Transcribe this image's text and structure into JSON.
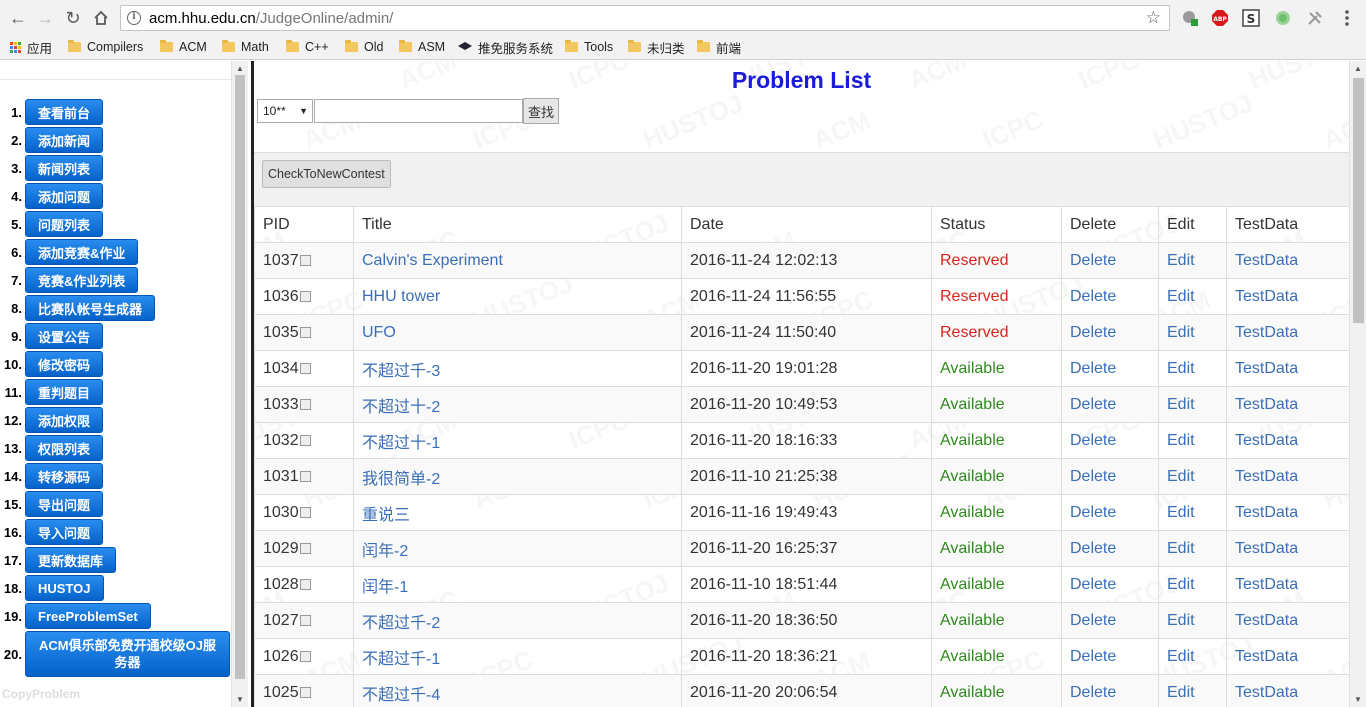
{
  "browser": {
    "url_host": "acm.hhu.edu.cn",
    "url_path": "/JudgeOnline/admin/"
  },
  "bookmarks": [
    {
      "label": "应用",
      "icon": "apps-grid-icon"
    },
    {
      "label": "Compilers",
      "icon": "folder-icon"
    },
    {
      "label": "ACM",
      "icon": "folder-icon"
    },
    {
      "label": "Math",
      "icon": "folder-icon"
    },
    {
      "label": "C++",
      "icon": "folder-icon"
    },
    {
      "label": "Old",
      "icon": "folder-icon"
    },
    {
      "label": "ASM",
      "icon": "folder-icon"
    },
    {
      "label": "推免服务系统",
      "icon": "graduation-cap-icon"
    },
    {
      "label": "Tools",
      "icon": "folder-icon"
    },
    {
      "label": "未归类",
      "icon": "folder-icon"
    },
    {
      "label": "前端",
      "icon": "folder-icon"
    }
  ],
  "sidebar": {
    "items": [
      {
        "num": "1.",
        "label": "查看前台"
      },
      {
        "num": "2.",
        "label": "添加新闻"
      },
      {
        "num": "3.",
        "label": "新闻列表"
      },
      {
        "num": "4.",
        "label": "添加问题"
      },
      {
        "num": "5.",
        "label": "问题列表"
      },
      {
        "num": "6.",
        "label": "添加竞赛&作业"
      },
      {
        "num": "7.",
        "label": "竞赛&作业列表"
      },
      {
        "num": "8.",
        "label": "比赛队帐号生成器"
      },
      {
        "num": "9.",
        "label": "设置公告"
      },
      {
        "num": "10.",
        "label": "修改密码"
      },
      {
        "num": "11.",
        "label": "重判题目"
      },
      {
        "num": "12.",
        "label": "添加权限"
      },
      {
        "num": "13.",
        "label": "权限列表"
      },
      {
        "num": "14.",
        "label": "转移源码"
      },
      {
        "num": "15.",
        "label": "导出问题"
      },
      {
        "num": "16.",
        "label": "导入问题"
      },
      {
        "num": "17.",
        "label": "更新数据库"
      },
      {
        "num": "18.",
        "label": "HUSTOJ"
      },
      {
        "num": "19.",
        "label": "FreeProblemSet"
      },
      {
        "num": "20.",
        "label": "ACM俱乐部免费开通校级OJ服务器"
      }
    ],
    "footer": "CopyProblem"
  },
  "main": {
    "title": "Problem List",
    "filter_value": "10**",
    "search_button": "查找",
    "check_button": "CheckToNewContest",
    "columns": [
      "PID",
      "Title",
      "Date",
      "Status",
      "Delete",
      "Edit",
      "TestData"
    ],
    "rows": [
      {
        "pid": "1037",
        "title": "Calvin's Experiment",
        "date": "2016-11-24 12:02:13",
        "status": "Reserved",
        "del": "Delete",
        "edit": "Edit",
        "test": "TestData"
      },
      {
        "pid": "1036",
        "title": "HHU tower",
        "date": "2016-11-24 11:56:55",
        "status": "Reserved",
        "del": "Delete",
        "edit": "Edit",
        "test": "TestData"
      },
      {
        "pid": "1035",
        "title": "UFO",
        "date": "2016-11-24 11:50:40",
        "status": "Reserved",
        "del": "Delete",
        "edit": "Edit",
        "test": "TestData"
      },
      {
        "pid": "1034",
        "title": "不超过千-3",
        "date": "2016-11-20 19:01:28",
        "status": "Available",
        "del": "Delete",
        "edit": "Edit",
        "test": "TestData"
      },
      {
        "pid": "1033",
        "title": "不超过十-2",
        "date": "2016-11-20 10:49:53",
        "status": "Available",
        "del": "Delete",
        "edit": "Edit",
        "test": "TestData"
      },
      {
        "pid": "1032",
        "title": "不超过十-1",
        "date": "2016-11-20 18:16:33",
        "status": "Available",
        "del": "Delete",
        "edit": "Edit",
        "test": "TestData"
      },
      {
        "pid": "1031",
        "title": "我很简单-2",
        "date": "2016-11-10 21:25:38",
        "status": "Available",
        "del": "Delete",
        "edit": "Edit",
        "test": "TestData"
      },
      {
        "pid": "1030",
        "title": "重说三",
        "date": "2016-11-16 19:49:43",
        "status": "Available",
        "del": "Delete",
        "edit": "Edit",
        "test": "TestData"
      },
      {
        "pid": "1029",
        "title": "闰年-2",
        "date": "2016-11-20 16:25:37",
        "status": "Available",
        "del": "Delete",
        "edit": "Edit",
        "test": "TestData"
      },
      {
        "pid": "1028",
        "title": "闰年-1",
        "date": "2016-11-10 18:51:44",
        "status": "Available",
        "del": "Delete",
        "edit": "Edit",
        "test": "TestData"
      },
      {
        "pid": "1027",
        "title": "不超过千-2",
        "date": "2016-11-20 18:36:50",
        "status": "Available",
        "del": "Delete",
        "edit": "Edit",
        "test": "TestData"
      },
      {
        "pid": "1026",
        "title": "不超过千-1",
        "date": "2016-11-20 18:36:21",
        "status": "Available",
        "del": "Delete",
        "edit": "Edit",
        "test": "TestData"
      },
      {
        "pid": "1025",
        "title": "不超过千-4",
        "date": "2016-11-20 20:06:54",
        "status": "Available",
        "del": "Delete",
        "edit": "Edit",
        "test": "TestData"
      }
    ]
  },
  "watermark_text": [
    "ACM",
    "ICPC",
    "HUSTOJ"
  ],
  "colors": {
    "title": "#1a1ad9",
    "menu_button": "#0a6fdc",
    "link": "#3a6fb7",
    "status_reserved": "#d9251d",
    "status_available": "#2e8a1e"
  }
}
